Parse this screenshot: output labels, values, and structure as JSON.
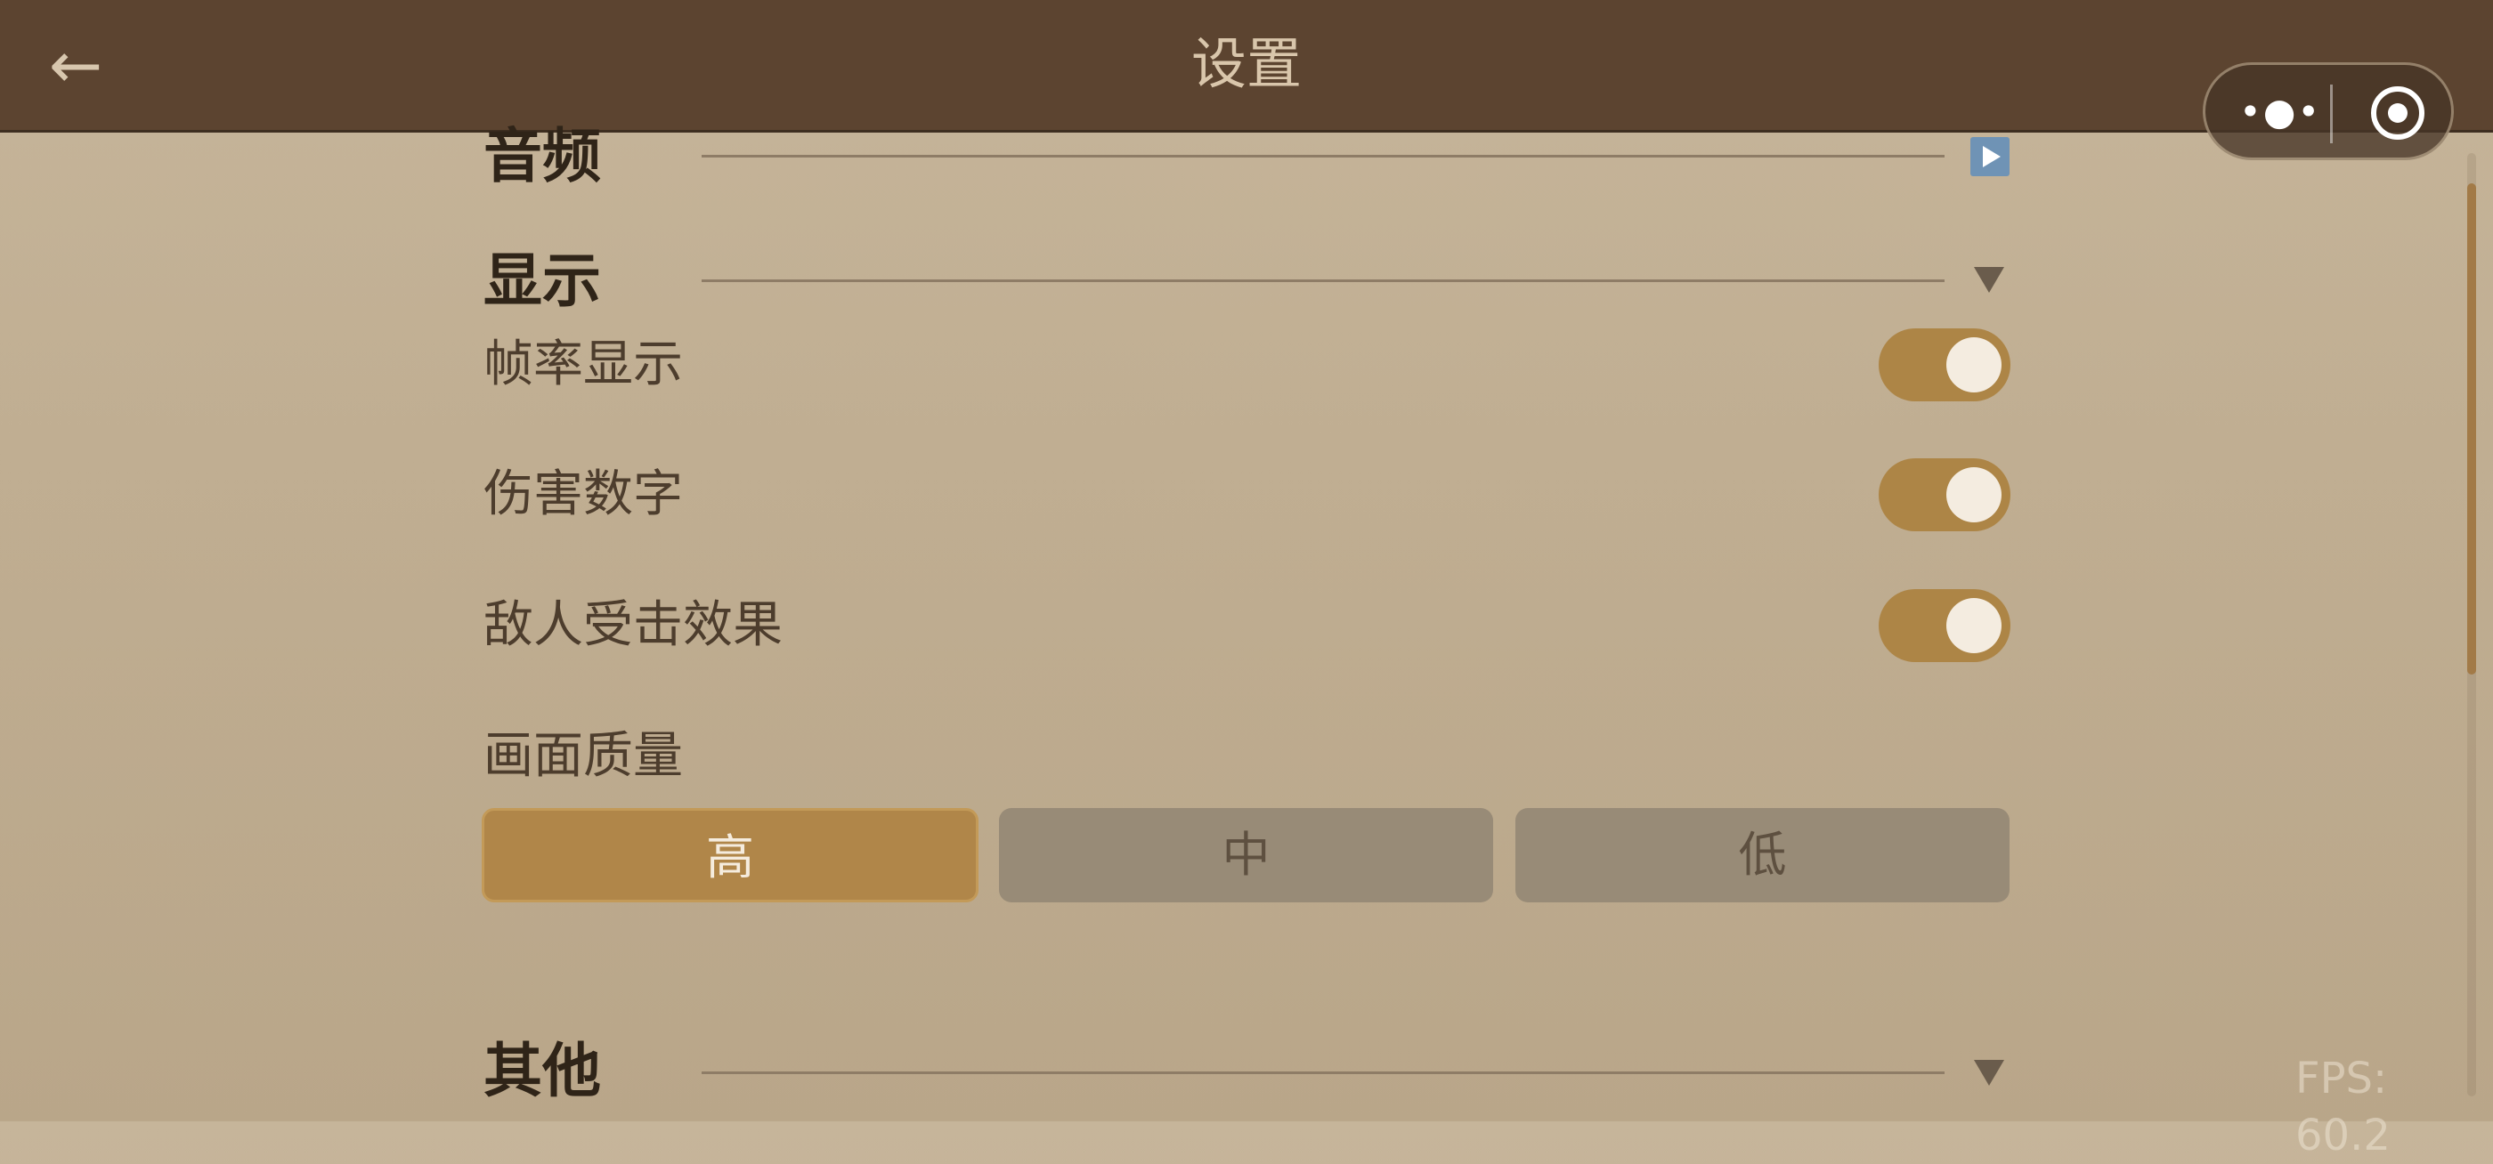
{
  "header": {
    "back_icon": "back-arrow-icon",
    "title": "设置",
    "capsule": {
      "more_icon": "more-dots-icon",
      "close_icon": "target-icon"
    }
  },
  "sections": {
    "audio": {
      "title": "音频",
      "icon": "play-icon",
      "icon_color": "#6f93b5"
    },
    "display": {
      "title": "显示",
      "icon": "triangle-down-icon",
      "toggles": [
        {
          "label": "帧率显示",
          "on": true
        },
        {
          "label": "伤害数字",
          "on": true
        },
        {
          "label": "敌人受击效果",
          "on": true
        }
      ],
      "quality": {
        "label": "画面质量",
        "options": [
          "高",
          "中",
          "低"
        ],
        "selected": "高"
      }
    },
    "other": {
      "title": "其他",
      "icon": "triangle-down-icon"
    }
  },
  "colors": {
    "header_bg": "#5c4430",
    "accent": "#ad8546",
    "inactive_button": "#988b77"
  },
  "fps_text": "FPS: 60.2"
}
